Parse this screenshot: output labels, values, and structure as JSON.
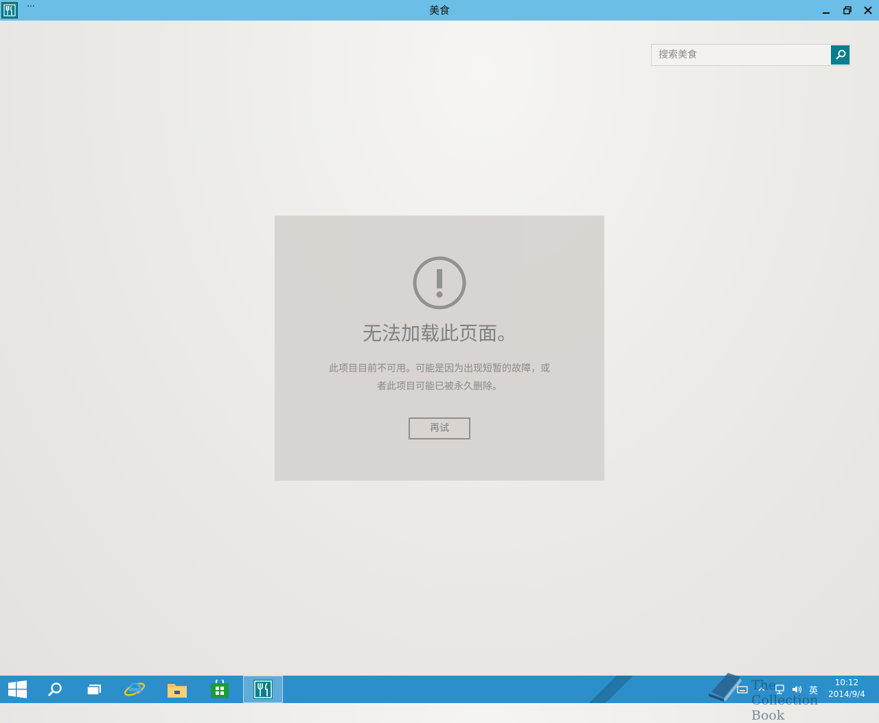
{
  "window": {
    "title": "美食",
    "more_label": "···"
  },
  "search": {
    "placeholder": "搜索美食",
    "value": ""
  },
  "error": {
    "title": "无法加载此页面。",
    "description_line1": "此项目目前不可用。可能是因为出现短暂的故障，或",
    "description_line2": "者此项目可能已被永久删除。",
    "retry_label": "再试"
  },
  "taskbar": {
    "items": [
      "start",
      "search",
      "task-view",
      "internet-explorer",
      "file-explorer",
      "store",
      "food-app"
    ],
    "tray_language": "英",
    "clock_time": "10:12",
    "clock_date": "2014/9/4",
    "watermark_text": "The Collection Book"
  },
  "colors": {
    "titlebar": "#6bbfe7",
    "accent": "#0a7e8c",
    "taskbar": "#2b8fcb",
    "panel": "#d6d3d0"
  }
}
